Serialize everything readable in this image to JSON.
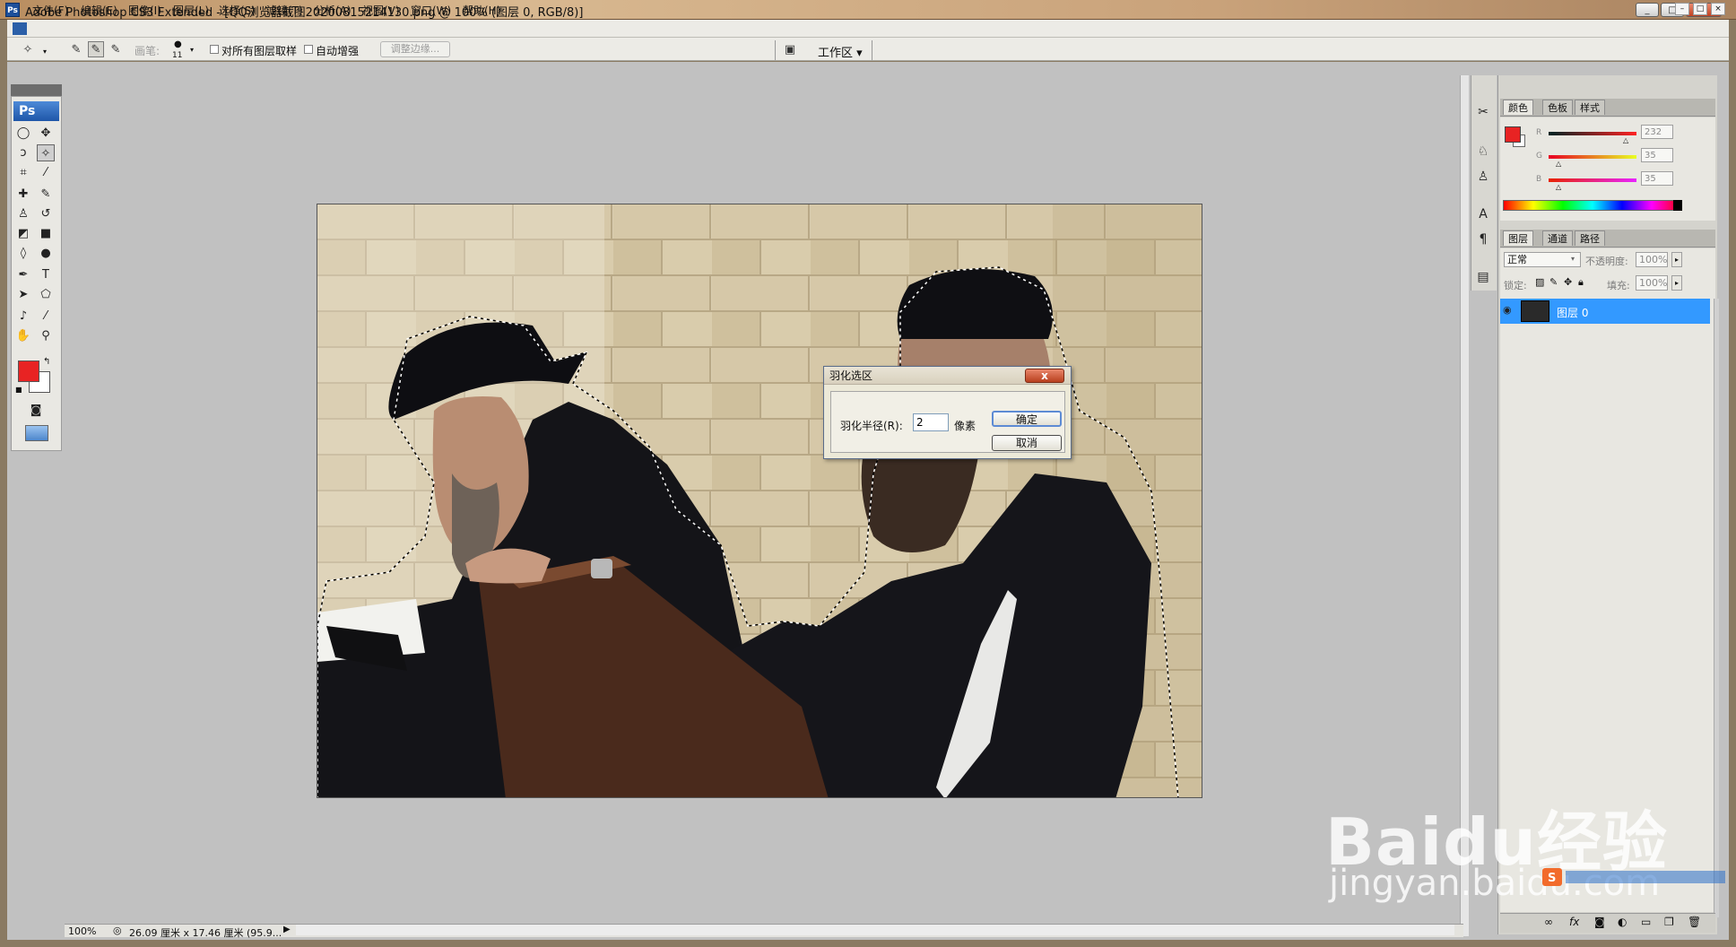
{
  "window": {
    "title": "Adobe Photoshop CS3 Extended - [QQ浏览器截图20200815214130.png @ 100% (图层 0, RGB/8)]",
    "app_icon": "Ps",
    "controls": [
      "_",
      "□",
      "×"
    ]
  },
  "menu": {
    "items": [
      "文件(F)",
      "编辑(E)",
      "图像(I)",
      "图层(L)",
      "选择(S)",
      "滤镜(T)",
      "分析(A)",
      "视图(V)",
      "窗口(W)",
      "帮助(H)"
    ],
    "doc_controls": [
      "–",
      "□",
      "×"
    ]
  },
  "options": {
    "brush_label": "画笔:",
    "brush_size": "11",
    "sample_all_label": "对所有图层取样",
    "auto_enhance_label": "自动增强",
    "refine_edge_label": "调整边缘...",
    "workspace_label": "工作区 ▾"
  },
  "toolbox": {
    "badge": "Ps"
  },
  "dialog": {
    "title": "羽化选区",
    "close_glyph": "x",
    "radius_label": "羽化半径(R):",
    "radius_value": "2",
    "unit": "像素",
    "ok": "确定",
    "cancel": "取消"
  },
  "color_panel": {
    "tabs": [
      "颜色",
      "色板",
      "样式"
    ],
    "foreground": "#e82323",
    "channels": [
      {
        "label": "R",
        "value": "232"
      },
      {
        "label": "G",
        "value": "35"
      },
      {
        "label": "B",
        "value": "35"
      }
    ]
  },
  "layers_panel": {
    "tabs": [
      "图层",
      "通道",
      "路径"
    ],
    "blend_mode": "正常",
    "opacity_label": "不透明度:",
    "opacity_value": "100%",
    "lock_label": "锁定:",
    "fill_label": "填充:",
    "fill_value": "100%",
    "layers": [
      {
        "name": "图层 0",
        "visible": true,
        "selected": true
      }
    ]
  },
  "status": {
    "zoom": "100%",
    "doc_size": "26.09 厘米 x 17.46 厘米 (95.9..."
  },
  "watermark": {
    "logo": "Baidu经验",
    "url": "jingyan.baidu.com"
  },
  "colors": {
    "accent": "#3399ff",
    "workspace_bg": "#c1c1c1",
    "foreground_swatch": "#e82323"
  }
}
